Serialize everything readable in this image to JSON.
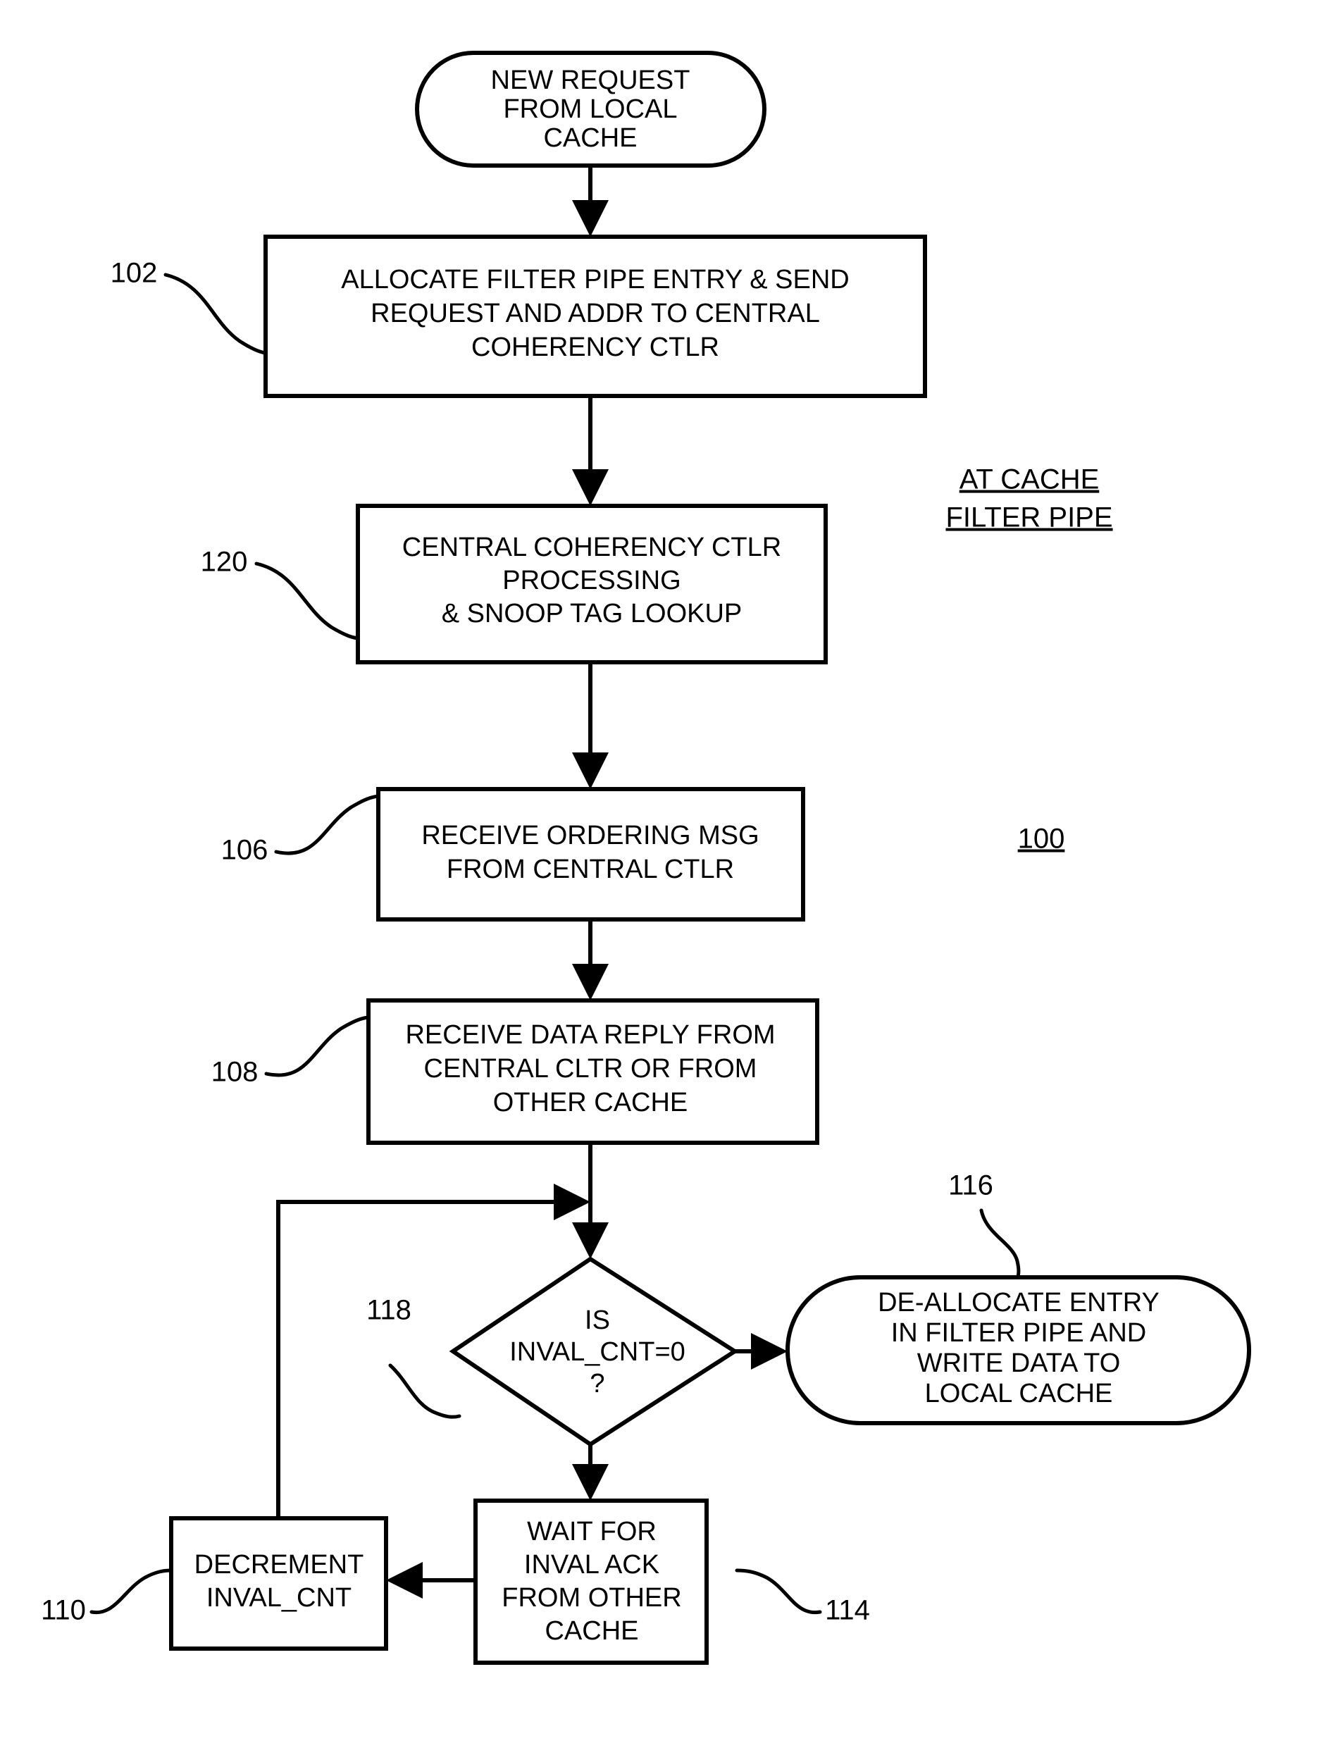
{
  "figure": {
    "title_note": {
      "line1": "AT CACHE",
      "line2": "FILTER PIPE"
    },
    "figure_ref": "100"
  },
  "nodes": {
    "start": {
      "ref": "",
      "shape": "stadium",
      "lines": [
        "NEW REQUEST",
        "FROM LOCAL",
        "CACHE"
      ]
    },
    "allocate": {
      "ref": "102",
      "shape": "rect",
      "lines": [
        "ALLOCATE FILTER PIPE ENTRY & SEND",
        "REQUEST AND ADDR TO CENTRAL",
        "COHERENCY CTLR"
      ]
    },
    "central": {
      "ref": "120",
      "shape": "rect",
      "lines": [
        "CENTRAL COHERENCY CTLR",
        "PROCESSING",
        "& SNOOP TAG LOOKUP"
      ]
    },
    "ordering": {
      "ref": "106",
      "shape": "rect",
      "lines": [
        "RECEIVE ORDERING MSG",
        "FROM CENTRAL CTLR"
      ]
    },
    "datareply": {
      "ref": "108",
      "shape": "rect",
      "lines": [
        "RECEIVE DATA REPLY FROM",
        "CENTRAL CLTR OR FROM",
        "OTHER CACHE"
      ]
    },
    "decision": {
      "ref": "118",
      "shape": "diamond",
      "lines": [
        "IS",
        "INVAL_CNT=0",
        "?"
      ]
    },
    "deallocate": {
      "ref": "116",
      "shape": "stadium",
      "lines": [
        "DE-ALLOCATE ENTRY",
        "IN FILTER PIPE AND",
        "WRITE DATA TO",
        "LOCAL  CACHE"
      ]
    },
    "wait": {
      "ref": "114",
      "shape": "rect",
      "lines": [
        "WAIT FOR",
        "INVAL ACK",
        "FROM OTHER",
        "CACHE"
      ]
    },
    "decrement": {
      "ref": "110",
      "shape": "rect",
      "lines": [
        "DECREMENT",
        "INVAL_CNT"
      ]
    }
  },
  "colors": {
    "stroke": "#000000",
    "fill": "#ffffff",
    "text": "#000000"
  }
}
